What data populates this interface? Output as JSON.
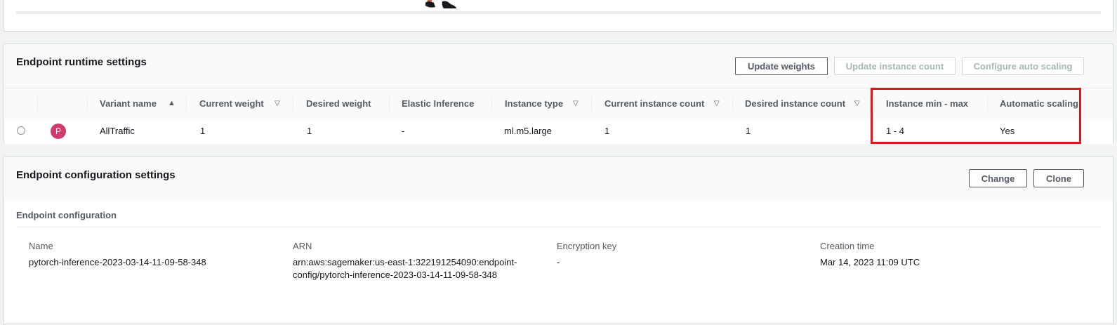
{
  "runtime": {
    "title": "Endpoint runtime settings",
    "buttons": {
      "update_weights": "Update weights",
      "update_instance_count": "Update instance count",
      "configure_auto_scaling": "Configure auto scaling"
    },
    "columns": {
      "variant_name": "Variant name",
      "current_weight": "Current weight",
      "desired_weight": "Desired weight",
      "elastic_inference": "Elastic Inference",
      "instance_type": "Instance type",
      "current_instance_count": "Current instance count",
      "desired_instance_count": "Desired instance count",
      "instance_min_max": "Instance min - max",
      "automatic_scaling": "Automatic scaling"
    },
    "rows": [
      {
        "badge": "P",
        "variant_name": "AllTraffic",
        "current_weight": "1",
        "desired_weight": "1",
        "elastic_inference": "-",
        "instance_type": "ml.m5.large",
        "current_instance_count": "1",
        "desired_instance_count": "1",
        "instance_min_max": "1 - 4",
        "automatic_scaling": "Yes"
      }
    ]
  },
  "config": {
    "title": "Endpoint configuration settings",
    "buttons": {
      "change": "Change",
      "clone": "Clone"
    },
    "section_label": "Endpoint configuration",
    "fields": {
      "name_label": "Name",
      "name_value": "pytorch-inference-2023-03-14-11-09-58-348",
      "arn_label": "ARN",
      "arn_value_line1": "arn:aws:sagemaker:us-east-1:322191254090:endpoint-",
      "arn_value_line2": "config/pytorch-inference-2023-03-14-11-09-58-348",
      "encryption_label": "Encryption key",
      "encryption_value": "-",
      "creation_label": "Creation time",
      "creation_value": "Mar 14, 2023 11:09 UTC"
    }
  },
  "colors": {
    "badge": "#d13c6a",
    "highlight_box": "#e3121b"
  }
}
